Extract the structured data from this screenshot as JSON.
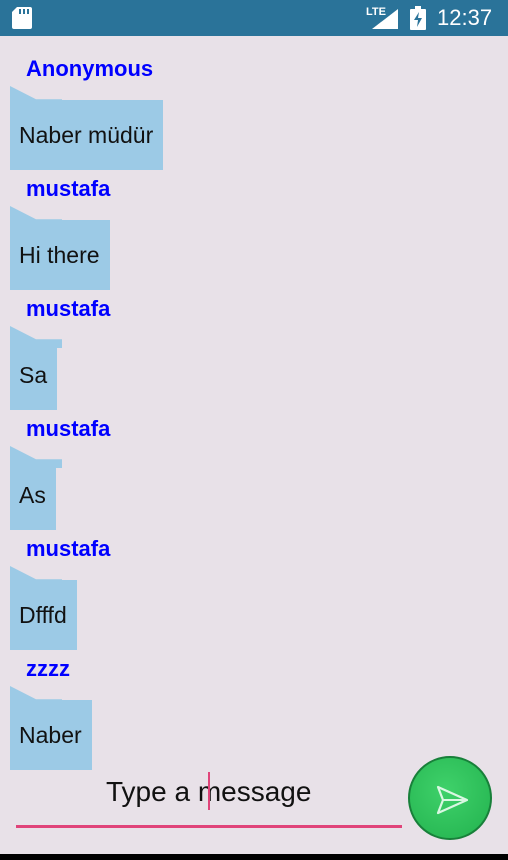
{
  "status_bar": {
    "network": "LTE",
    "time": "12:37",
    "icons": [
      "sd-card-icon",
      "signal-icon",
      "battery-charging-icon"
    ]
  },
  "messages": [
    {
      "sender": "Anonymous",
      "text": "Naber müdür"
    },
    {
      "sender": "mustafa",
      "text": "Hi there"
    },
    {
      "sender": "mustafa",
      "text": "Sa"
    },
    {
      "sender": "mustafa",
      "text": "As"
    },
    {
      "sender": "mustafa",
      "text": "Dfffd"
    },
    {
      "sender": "zzzz",
      "text": "Naber"
    }
  ],
  "composer": {
    "placeholder": "Type a message",
    "send_icon": "send-icon"
  },
  "colors": {
    "status_bar": "#2a7399",
    "background": "#e8e1e8",
    "bubble": "#9ccae6",
    "sender_name": "#0000ff",
    "input_underline": "#e0447a",
    "send_button": "#2dbf58"
  }
}
